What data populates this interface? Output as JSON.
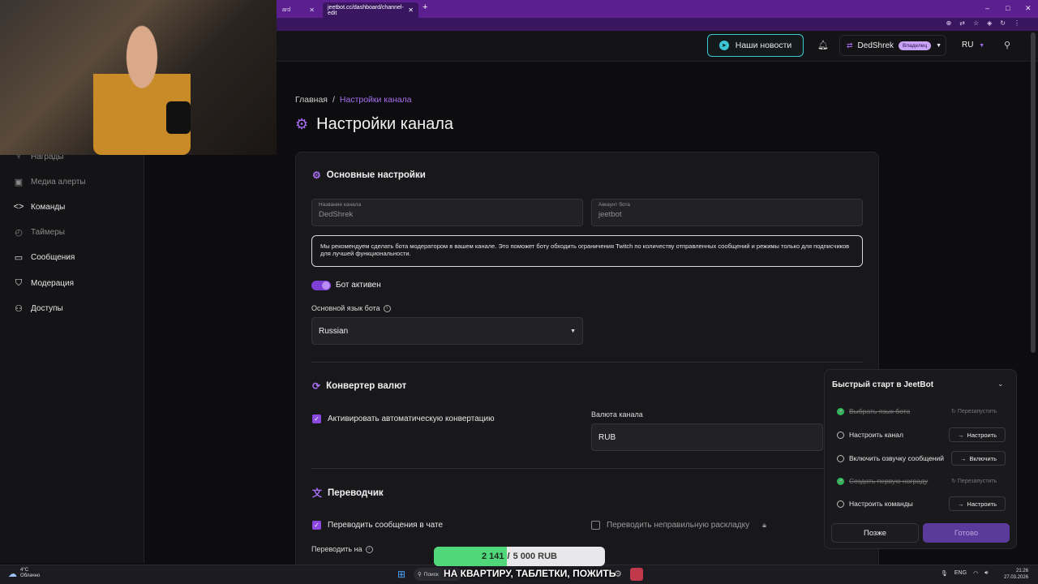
{
  "browser": {
    "tabs": [
      {
        "label": "ard"
      },
      {
        "label": "jeetbot.cc/dashboard/channel-edit"
      }
    ],
    "new_tab": "+",
    "window_controls": [
      "–",
      "□",
      "✕"
    ]
  },
  "header": {
    "news_button": "Наши новости",
    "username": "DedShrek",
    "owner_badge": "Владелец",
    "language": "RU"
  },
  "sidebar": {
    "items": [
      {
        "label": "Награды",
        "icon": "award-icon",
        "dim": true
      },
      {
        "label": "Медиа алерты",
        "icon": "media-icon",
        "dim": true
      },
      {
        "label": "Команды",
        "icon": "code-icon",
        "dim": false
      },
      {
        "label": "Таймеры",
        "icon": "timer-icon",
        "dim": true
      },
      {
        "label": "Сообщения",
        "icon": "message-icon",
        "dim": false
      },
      {
        "label": "Модерация",
        "icon": "shield-icon",
        "dim": false
      },
      {
        "label": "Доступы",
        "icon": "users-icon",
        "dim": false
      }
    ]
  },
  "breadcrumb": {
    "home": "Главная",
    "separator": "/",
    "current": "Настройки канала"
  },
  "page": {
    "title": "Настройки канала"
  },
  "basic": {
    "title": "Основные настройки",
    "channel_name_label": "Название канала",
    "channel_name_value": "DedShrek",
    "bot_account_label": "Аккаунт бота",
    "bot_account_value": "jeetbot",
    "hint": "Мы рекомендуем сделать бота модератором в вашем канале. Это поможет боту обходить ограничения Twitch по количеству отправленных сообщений и режимы только для подписчиков для лучшей функциональности.",
    "bot_active_label": "Бот активен",
    "bot_active": true,
    "bot_language_label": "Основной язык бота",
    "bot_language_value": "Russian"
  },
  "currency": {
    "title": "Конвертер валют",
    "auto_convert_label": "Активировать автоматическую конвертацию",
    "auto_convert": true,
    "channel_currency_label": "Валюта канала",
    "channel_currency_value": "RUB"
  },
  "translator": {
    "title": "Переводчик",
    "translate_chat_label": "Переводить сообщения в чате",
    "translate_chat": true,
    "wrong_layout_label": "Переводить неправильную раскладку",
    "wrong_layout": false,
    "translate_to_label": "Переводить на"
  },
  "quick_start": {
    "title": "Быстрый старт в JeetBot",
    "steps": [
      {
        "label": "Выбрать язык бота",
        "done": true,
        "action": "Перезапустить"
      },
      {
        "label": "Настроить канал",
        "done": false,
        "action": "Настроить"
      },
      {
        "label": "Включить озвучку сообщений",
        "done": false,
        "action": "Включить"
      },
      {
        "label": "Создать первую награду",
        "done": true,
        "action": "Перезапустить"
      },
      {
        "label": "Настроить команды",
        "done": false,
        "action": "Настроить"
      }
    ],
    "later_button": "Позже",
    "done_button": "Готово"
  },
  "donation": {
    "current": "2 141",
    "separator": "/",
    "goal": "5 000 RUB",
    "progress": 0.4282,
    "goal_text": "НА КВАРТИРУ, ТАБЛЕТКИ, ПОЖИТЬ"
  },
  "taskbar": {
    "weather_temp": "4°C",
    "weather_text": "Облачно",
    "search": "Поиск",
    "lang": "ENG",
    "time": "21:26",
    "date": "27.03.2026"
  },
  "colors": {
    "accent": "#a76ef2",
    "brand_bar": "#5b1f8f",
    "news_border": "#3ac7d6",
    "progress": "#4fd77a",
    "success": "#2fb85a"
  }
}
